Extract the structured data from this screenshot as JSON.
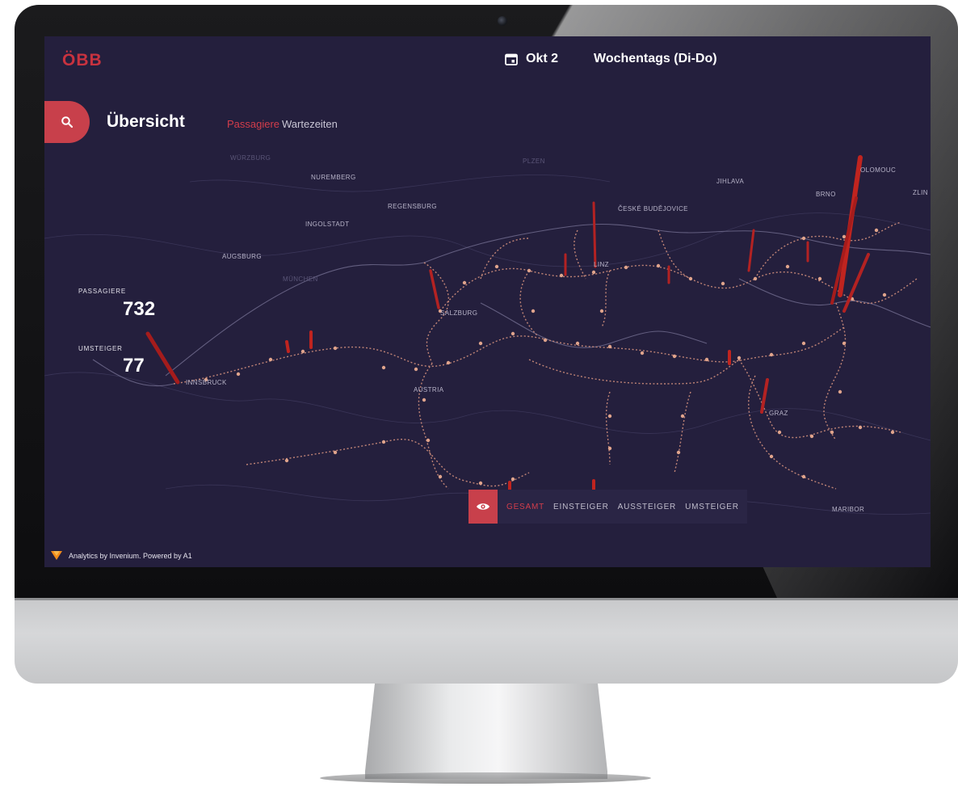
{
  "app": {
    "logo": "ÖBB",
    "date": "Okt 2",
    "day_type": "Wochentags (Di-Do)"
  },
  "header": {
    "title": "Übersicht",
    "tabs": [
      {
        "label": "Passagiere",
        "active": true
      },
      {
        "label": "Wartezeiten",
        "active": false
      }
    ]
  },
  "stats": {
    "passengers_label": "PASSAGIERE",
    "passengers_value": "732",
    "transfers_label": "UMSTEIGER",
    "transfers_value": "77"
  },
  "map_labels": {
    "wurzburg": "WÜRZBURG",
    "nuremberg": "NUREMBERG",
    "regensburg": "REGENSBURG",
    "ingolstadt": "INGOLSTADT",
    "augsburg": "AUGSBURG",
    "munchen": "MÜNCHEN",
    "plzen": "PLZEN",
    "jihlava": "JIHLAVA",
    "brno": "BRNO",
    "olomouc": "OLOMOUC",
    "zlin": "ZLIN",
    "ceske": "ČESKÉ BUDĚJOVICE",
    "salzburg": "SALZBURG",
    "innsbruck": "INNSBRUCK",
    "austria": "AUSTRIA",
    "graz": "GRAZ",
    "maribor": "MARIBOR",
    "linz": "LINZ"
  },
  "mode_bar": {
    "items": [
      {
        "label": "GESAMT",
        "active": true
      },
      {
        "label": "EINSTEIGER",
        "active": false
      },
      {
        "label": "AUSSTEIGER",
        "active": false
      },
      {
        "label": "UMSTEIGER",
        "active": false
      }
    ]
  },
  "footer": {
    "text": "Analytics by Invenium. Powered by A1"
  },
  "colors": {
    "accent": "#c8404b",
    "background": "#241f3d",
    "bar": "#b32222"
  },
  "icons": {
    "search": "search-icon",
    "calendar": "calendar-icon",
    "eye": "eye-icon",
    "brand": "invenium-logo-icon"
  }
}
